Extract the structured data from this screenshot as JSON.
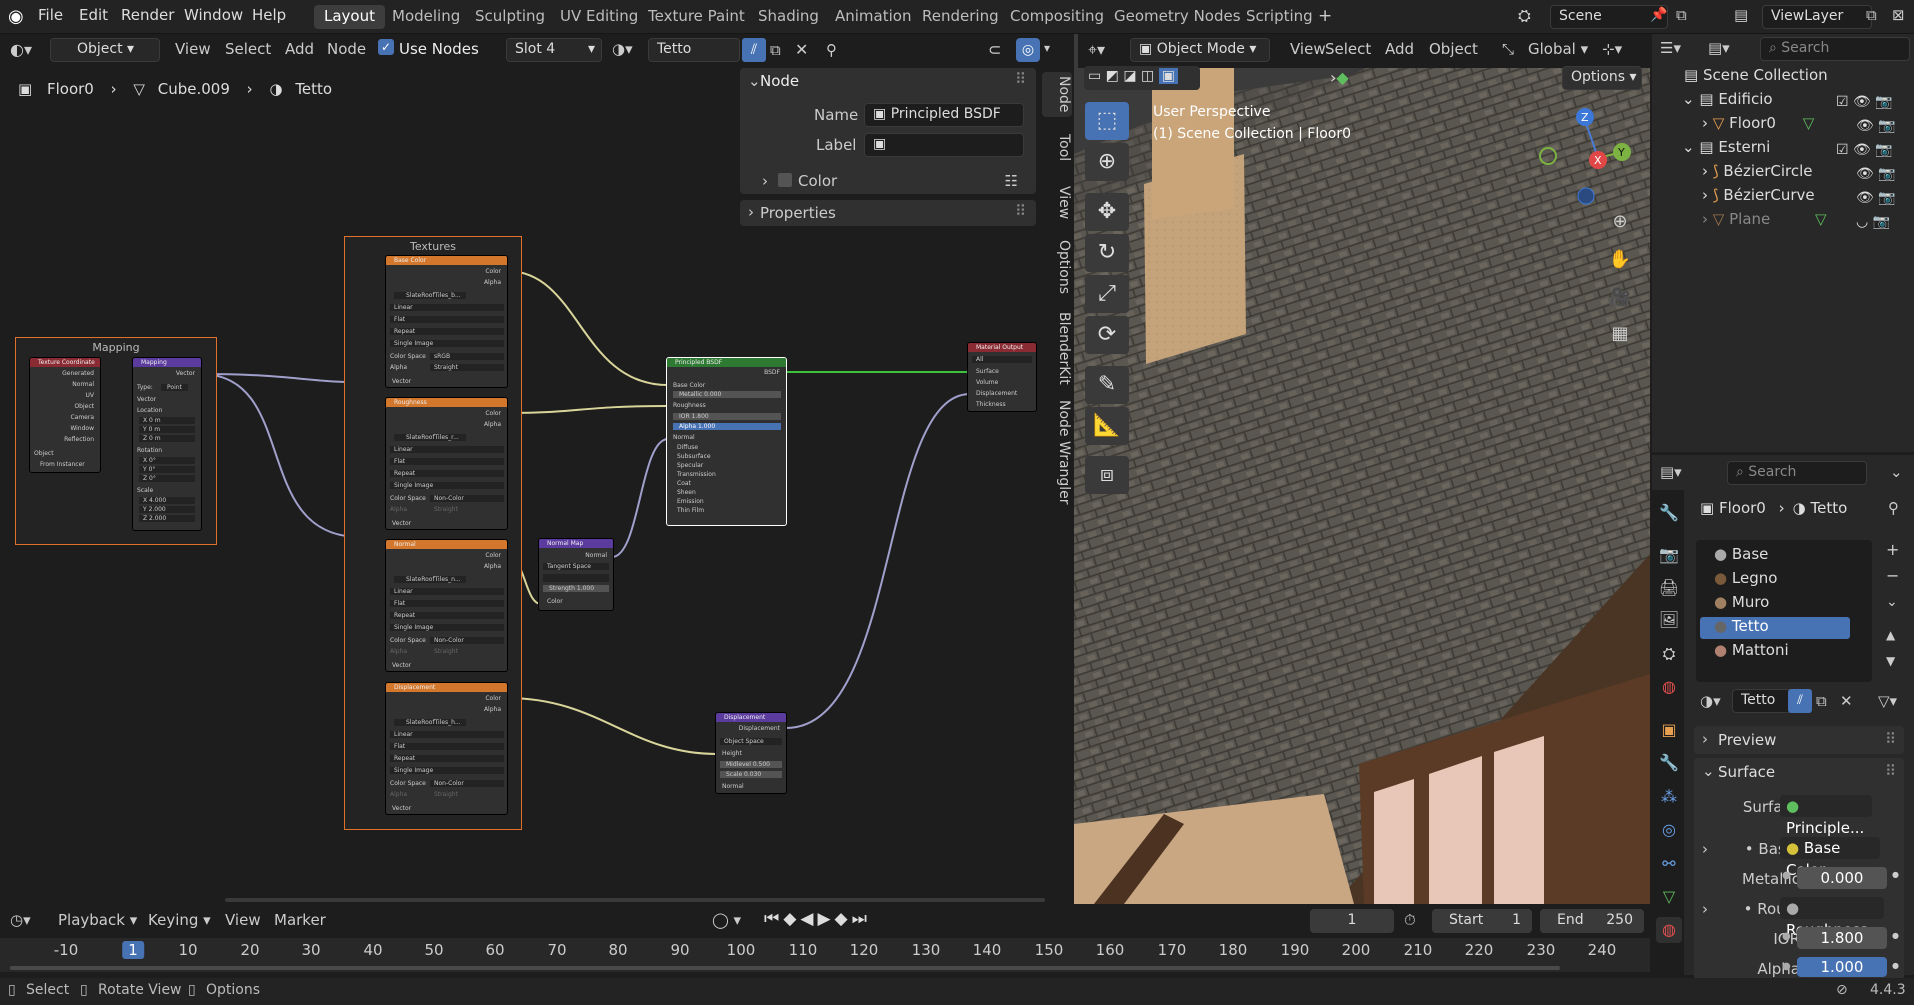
{
  "menu": {
    "file": "File",
    "edit": "Edit",
    "render": "Render",
    "window": "Window",
    "help": "Help"
  },
  "workspaces": [
    "Layout",
    "Modeling",
    "Sculpting",
    "UV Editing",
    "Texture Paint",
    "Shading",
    "Animation",
    "Rendering",
    "Compositing",
    "Geometry Nodes",
    "Scripting"
  ],
  "scene": "Scene",
  "view_layer": "ViewLayer",
  "node_editor": {
    "mode": "Object",
    "view": "View",
    "select": "Select",
    "add": "Add",
    "node": "Node",
    "use_nodes": "Use Nodes",
    "slot": "Slot 4",
    "material": "Tetto"
  },
  "breadcrumb": {
    "obj": "Floor0",
    "mesh": "Cube.009",
    "mat": "Tetto"
  },
  "npanel": {
    "section": "Node",
    "name_label": "Name",
    "name_value": "Principled BSDF",
    "label_label": "Label",
    "color": "Color",
    "properties": "Properties",
    "tabs": [
      "Node",
      "Tool",
      "View",
      "Options",
      "BlenderKit",
      "Node Wrangler"
    ]
  },
  "frames": {
    "mapping": "Mapping",
    "textures": "Textures"
  },
  "nodes": {
    "texcoord": {
      "title": "Texture Coordinate",
      "outs": [
        "Generated",
        "Normal",
        "UV",
        "Object",
        "Camera",
        "Window",
        "Reflection"
      ],
      "object": "Object",
      "from_instancer": "From Instancer"
    },
    "mapping": {
      "title": "Mapping",
      "vector": "Vector",
      "type": "Type:",
      "type_val": "Point",
      "rows": [
        "Vector",
        "Location",
        "X 0 m",
        "Y 0 m",
        "Z 0 m",
        "Rotation",
        "X 0°",
        "Y 0°",
        "Z 0°",
        "Scale",
        "X 4.000",
        "Y 2.000",
        "Z 2.000"
      ]
    },
    "tex_base": {
      "title": "Base Color",
      "img": "SlateRoofTiles_b...",
      "rows": [
        "Linear",
        "Flat",
        "Repeat",
        "Single Image"
      ],
      "cs": "Color Space",
      "cs_val": "sRGB",
      "alpha": "Alpha",
      "alpha_val": "Straight",
      "vector": "Vector"
    },
    "tex_rough": {
      "title": "Roughness",
      "img": "SlateRoofTiles_r...",
      "cs_val": "Non-Color"
    },
    "tex_normal": {
      "title": "Normal",
      "img": "SlateRoofTiles_n...",
      "cs_val": "Non-Color"
    },
    "tex_disp": {
      "title": "Displacement",
      "img": "SlateRoofTiles_h...",
      "cs_val": "Non-Color"
    },
    "normalmap": {
      "title": "Normal Map",
      "normal": "Normal",
      "space": "Tangent Space",
      "strength": "Strength",
      "strength_val": "1.000",
      "color": "Color"
    },
    "bsdf": {
      "title": "Principled BSDF",
      "out": "BSDF",
      "rows": [
        "Base Color",
        "Metallic 0.000",
        "Roughness",
        "IOR 1.800",
        "Alpha 1.000",
        "Normal",
        "Diffuse",
        "Subsurface",
        "Specular",
        "Transmission",
        "Coat",
        "Sheen",
        "Emission",
        "Thin Film"
      ]
    },
    "output": {
      "title": "Material Output",
      "target": "All",
      "ins": [
        "Surface",
        "Volume",
        "Displacement",
        "Thickness"
      ]
    },
    "disp": {
      "title": "Displacement",
      "out": "Displacement",
      "space": "Object Space",
      "height": "Height",
      "mid": "Midlevel 0.500",
      "scale": "Scale 0.030",
      "normal": "Normal"
    },
    "tex_outs": {
      "color": "Color",
      "alpha": "Alpha"
    }
  },
  "viewport": {
    "mode": "Object Mode",
    "view": "View",
    "select": "Select",
    "add": "Add",
    "object": "Object",
    "orient": "Global",
    "options": "Options",
    "overlay1": "User Perspective",
    "overlay2": "(1) Scene Collection | Floor0"
  },
  "outliner": {
    "search": "Search",
    "items": [
      "Scene Collection",
      "Edificio",
      "Floor0",
      "Esterni",
      "BézierCircle",
      "BézierCurve",
      "Plane"
    ]
  },
  "properties": {
    "search": "Search",
    "path_obj": "Floor0",
    "path_mat": "Tetto",
    "materials": [
      "Base",
      "Legno",
      "Muro",
      "Tetto",
      "Mattoni"
    ],
    "mat_name": "Tetto",
    "preview": "Preview",
    "surface": "Surface",
    "surface_label": "Surface",
    "surface_val": "Principle...",
    "base_label": "• Bas...",
    "base_val": "Base Color",
    "metallic_label": "Metallic",
    "metallic_val": "0.000",
    "rough_label": "• Rou...",
    "rough_val": "Roughness",
    "ior_label": "IOR",
    "ior_val": "1.800",
    "alpha_label": "Alpha",
    "alpha_val": "1.000"
  },
  "timeline": {
    "playback": "Playback",
    "keying": "Keying",
    "view": "View",
    "marker": "Marker",
    "frame": "1",
    "start_label": "Start",
    "start": "1",
    "end_label": "End",
    "end": "250",
    "ticks": [
      "-10",
      "1",
      "10",
      "20",
      "30",
      "40",
      "50",
      "60",
      "70",
      "80",
      "90",
      "100",
      "110",
      "120",
      "130",
      "140",
      "150",
      "160",
      "170",
      "180",
      "190",
      "200",
      "210",
      "220",
      "230",
      "240"
    ]
  },
  "status": {
    "select": "Select",
    "rotate": "Rotate View",
    "options": "Options",
    "version": "4.4.3"
  },
  "colors": {
    "accent": "#4772b3",
    "frame": "#e0702a",
    "texture_header": "#d2772c",
    "bsdf_header": "#2f7a33",
    "output_header": "#8a2b33",
    "vector_header": "#5b3b9e",
    "wire": "#d8d49a",
    "wire_vec": "#a1a0cc",
    "wire_green": "#3ec23e"
  }
}
